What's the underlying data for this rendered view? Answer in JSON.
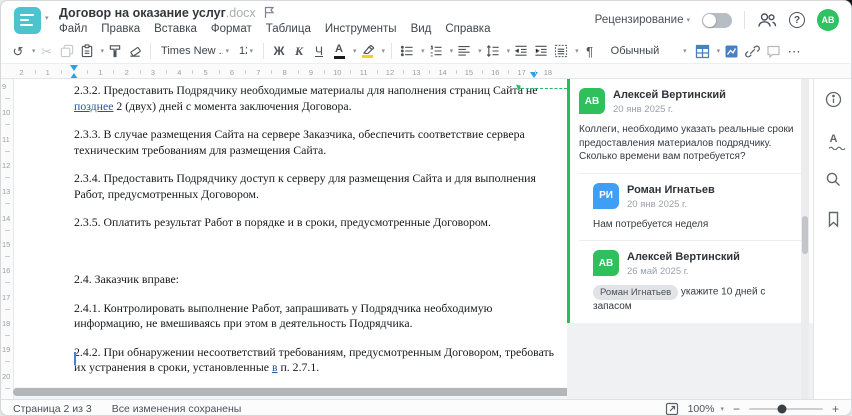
{
  "header": {
    "doc_title": "Договор на оказание услуг",
    "doc_ext": ".docx",
    "menu": [
      "Файл",
      "Правка",
      "Вставка",
      "Формат",
      "Таблица",
      "Инструменты",
      "Вид",
      "Справка"
    ],
    "review_label": "Рецензирование",
    "review_toggle_on": false,
    "avatar_initials": "АВ",
    "avatar_color": "#2ec262"
  },
  "icons": {
    "undo": "↺",
    "cut": "✂",
    "bold": "Ж",
    "italic": "К",
    "underline": "Ч",
    "font_color_letter": "А",
    "pilcrow": "¶",
    "more": "⋯",
    "dropdown_caret": "▾",
    "help": "?",
    "info": "i",
    "spell_letter": "А",
    "flag": "⚐",
    "minus": "−",
    "plus": "+"
  },
  "toolbar": {
    "font_name": "Times New ...",
    "font_size": "12",
    "style_name": "Обычный",
    "accent_blue": "#4a7fc0"
  },
  "ruler": {
    "h_left": [
      "2",
      "1"
    ],
    "h_right": [
      "1",
      "2",
      "3",
      "4",
      "5",
      "6",
      "7",
      "8",
      "9",
      "10",
      "11",
      "12",
      "13",
      "14",
      "15",
      "16",
      "17",
      "18"
    ],
    "v": [
      "9",
      "10",
      "11",
      "12",
      "13",
      "14",
      "15",
      "16",
      "17",
      "18",
      "19",
      "20"
    ],
    "marker_color": "#2ba0e8"
  },
  "document": {
    "paragraphs": [
      {
        "lines": [
          [
            {
              "t": "2.3.2. Предоставить Подрядчику необходимые материалы для наполнения страниц Сайта не"
            }
          ],
          [
            {
              "t": "позднее",
              "marked": true
            },
            {
              "t": " 2 (двух) дней с момента заключения Договора."
            }
          ]
        ]
      },
      {
        "lines": [
          [
            {
              "t": "2.3.3. В случае размещения Сайта на сервере Заказчика, обеспечить соответствие сервера"
            }
          ],
          [
            {
              "t": "техническим требованиям для размещения Сайта."
            }
          ]
        ]
      },
      {
        "lines": [
          [
            {
              "t": "2.3.4. Предоставить Подрядчику доступ к серверу для размещения Сайта и для выполнения"
            }
          ],
          [
            {
              "t": "Работ, предусмотренных Договором."
            }
          ]
        ]
      },
      {
        "lines": [
          [
            {
              "t": "2.3.5. Оплатить результат Работ в порядке и в сроки, предусмотренные Договором."
            }
          ]
        ]
      },
      {
        "blank": true,
        "lines": [
          [
            {
              "t": ""
            }
          ]
        ]
      },
      {
        "lines": [
          [
            {
              "t": "2.4. Заказчик вправе:"
            }
          ]
        ]
      },
      {
        "lines": [
          [
            {
              "t": "2.4.1. Контролировать выполнение Работ, запрашивать у Подрядчика необходимую"
            }
          ],
          [
            {
              "t": "информацию, не вмешиваясь при этом в деятельность Подрядчика."
            }
          ]
        ]
      },
      {
        "lines": [
          [
            {
              "t": "2.4.2. При обнаружении несоответствий требованиям, предусмотренным Договором, требовать"
            }
          ],
          [
            {
              "t": "их устранения в сроки, установленные "
            },
            {
              "t": "в",
              "marked": true
            },
            {
              "t": " п. 2.7.1."
            }
          ]
        ]
      }
    ]
  },
  "comments": {
    "anchor_color": "#27bd5e",
    "thread": [
      {
        "initials": "АВ",
        "color": "#2fc05c",
        "name": "Алексей Вертинский",
        "date": "20 янв 2025 г.",
        "text": "Коллеги, необходимо указать реальные сроки предоставления материалов подрядчику. Сколько времени вам потребуется?",
        "reply": false
      },
      {
        "initials": "РИ",
        "color": "#3f9ef5",
        "name": "Роман Игнатьев",
        "date": "20 янв 2025 г.",
        "text": "Нам потребуется неделя",
        "reply": true
      },
      {
        "initials": "АВ",
        "color": "#2fc05c",
        "name": "Алексей Вертинский",
        "date": "26 май 2025 г.",
        "mention": "Роман Игнатьев",
        "text": "укажите 10 дней с запасом",
        "reply": true
      }
    ]
  },
  "statusbar": {
    "page_info": "Страница 2 из 3",
    "save_status": "Все изменения сохранены",
    "zoom_value": "100%"
  }
}
